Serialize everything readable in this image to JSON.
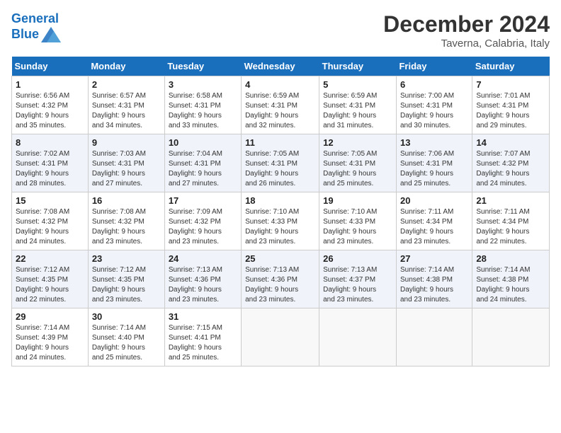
{
  "header": {
    "logo_line1": "General",
    "logo_line2": "Blue",
    "month": "December 2024",
    "location": "Taverna, Calabria, Italy"
  },
  "weekdays": [
    "Sunday",
    "Monday",
    "Tuesday",
    "Wednesday",
    "Thursday",
    "Friday",
    "Saturday"
  ],
  "weeks": [
    [
      {
        "day": "1",
        "info": "Sunrise: 6:56 AM\nSunset: 4:32 PM\nDaylight: 9 hours\nand 35 minutes."
      },
      {
        "day": "2",
        "info": "Sunrise: 6:57 AM\nSunset: 4:31 PM\nDaylight: 9 hours\nand 34 minutes."
      },
      {
        "day": "3",
        "info": "Sunrise: 6:58 AM\nSunset: 4:31 PM\nDaylight: 9 hours\nand 33 minutes."
      },
      {
        "day": "4",
        "info": "Sunrise: 6:59 AM\nSunset: 4:31 PM\nDaylight: 9 hours\nand 32 minutes."
      },
      {
        "day": "5",
        "info": "Sunrise: 6:59 AM\nSunset: 4:31 PM\nDaylight: 9 hours\nand 31 minutes."
      },
      {
        "day": "6",
        "info": "Sunrise: 7:00 AM\nSunset: 4:31 PM\nDaylight: 9 hours\nand 30 minutes."
      },
      {
        "day": "7",
        "info": "Sunrise: 7:01 AM\nSunset: 4:31 PM\nDaylight: 9 hours\nand 29 minutes."
      }
    ],
    [
      {
        "day": "8",
        "info": "Sunrise: 7:02 AM\nSunset: 4:31 PM\nDaylight: 9 hours\nand 28 minutes."
      },
      {
        "day": "9",
        "info": "Sunrise: 7:03 AM\nSunset: 4:31 PM\nDaylight: 9 hours\nand 27 minutes."
      },
      {
        "day": "10",
        "info": "Sunrise: 7:04 AM\nSunset: 4:31 PM\nDaylight: 9 hours\nand 27 minutes."
      },
      {
        "day": "11",
        "info": "Sunrise: 7:05 AM\nSunset: 4:31 PM\nDaylight: 9 hours\nand 26 minutes."
      },
      {
        "day": "12",
        "info": "Sunrise: 7:05 AM\nSunset: 4:31 PM\nDaylight: 9 hours\nand 25 minutes."
      },
      {
        "day": "13",
        "info": "Sunrise: 7:06 AM\nSunset: 4:31 PM\nDaylight: 9 hours\nand 25 minutes."
      },
      {
        "day": "14",
        "info": "Sunrise: 7:07 AM\nSunset: 4:32 PM\nDaylight: 9 hours\nand 24 minutes."
      }
    ],
    [
      {
        "day": "15",
        "info": "Sunrise: 7:08 AM\nSunset: 4:32 PM\nDaylight: 9 hours\nand 24 minutes."
      },
      {
        "day": "16",
        "info": "Sunrise: 7:08 AM\nSunset: 4:32 PM\nDaylight: 9 hours\nand 23 minutes."
      },
      {
        "day": "17",
        "info": "Sunrise: 7:09 AM\nSunset: 4:32 PM\nDaylight: 9 hours\nand 23 minutes."
      },
      {
        "day": "18",
        "info": "Sunrise: 7:10 AM\nSunset: 4:33 PM\nDaylight: 9 hours\nand 23 minutes."
      },
      {
        "day": "19",
        "info": "Sunrise: 7:10 AM\nSunset: 4:33 PM\nDaylight: 9 hours\nand 23 minutes."
      },
      {
        "day": "20",
        "info": "Sunrise: 7:11 AM\nSunset: 4:34 PM\nDaylight: 9 hours\nand 23 minutes."
      },
      {
        "day": "21",
        "info": "Sunrise: 7:11 AM\nSunset: 4:34 PM\nDaylight: 9 hours\nand 22 minutes."
      }
    ],
    [
      {
        "day": "22",
        "info": "Sunrise: 7:12 AM\nSunset: 4:35 PM\nDaylight: 9 hours\nand 22 minutes."
      },
      {
        "day": "23",
        "info": "Sunrise: 7:12 AM\nSunset: 4:35 PM\nDaylight: 9 hours\nand 23 minutes."
      },
      {
        "day": "24",
        "info": "Sunrise: 7:13 AM\nSunset: 4:36 PM\nDaylight: 9 hours\nand 23 minutes."
      },
      {
        "day": "25",
        "info": "Sunrise: 7:13 AM\nSunset: 4:36 PM\nDaylight: 9 hours\nand 23 minutes."
      },
      {
        "day": "26",
        "info": "Sunrise: 7:13 AM\nSunset: 4:37 PM\nDaylight: 9 hours\nand 23 minutes."
      },
      {
        "day": "27",
        "info": "Sunrise: 7:14 AM\nSunset: 4:38 PM\nDaylight: 9 hours\nand 23 minutes."
      },
      {
        "day": "28",
        "info": "Sunrise: 7:14 AM\nSunset: 4:38 PM\nDaylight: 9 hours\nand 24 minutes."
      }
    ],
    [
      {
        "day": "29",
        "info": "Sunrise: 7:14 AM\nSunset: 4:39 PM\nDaylight: 9 hours\nand 24 minutes."
      },
      {
        "day": "30",
        "info": "Sunrise: 7:14 AM\nSunset: 4:40 PM\nDaylight: 9 hours\nand 25 minutes."
      },
      {
        "day": "31",
        "info": "Sunrise: 7:15 AM\nSunset: 4:41 PM\nDaylight: 9 hours\nand 25 minutes."
      },
      {
        "day": "",
        "info": ""
      },
      {
        "day": "",
        "info": ""
      },
      {
        "day": "",
        "info": ""
      },
      {
        "day": "",
        "info": ""
      }
    ]
  ]
}
